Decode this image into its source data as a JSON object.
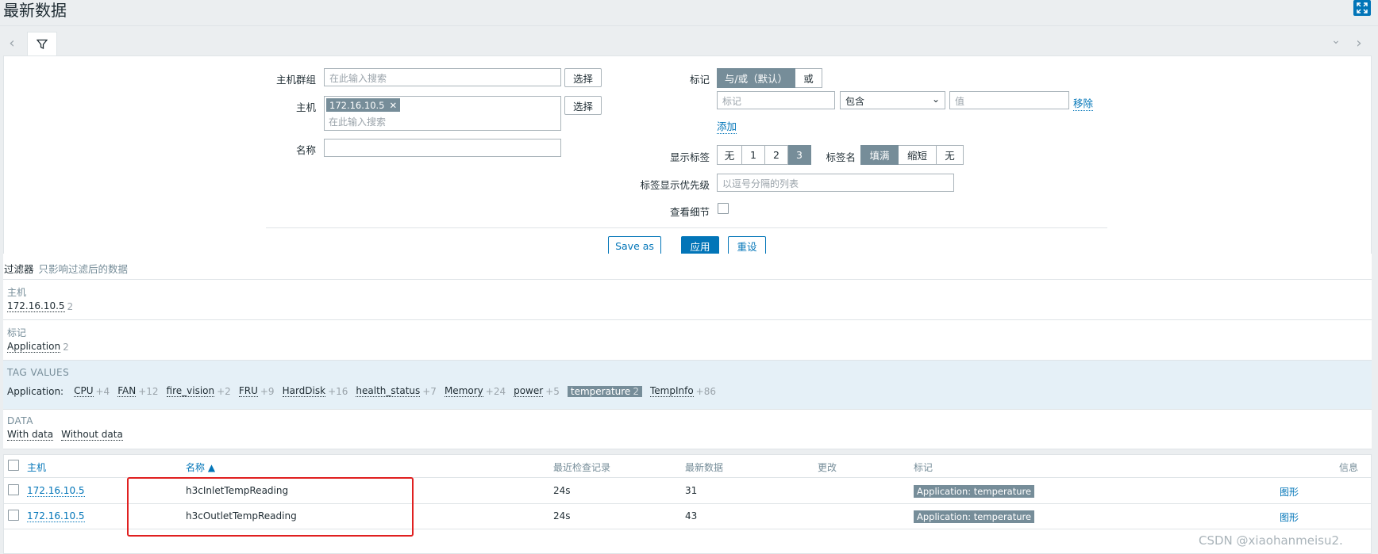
{
  "page": {
    "title": "最新数据"
  },
  "filter": {
    "host_groups_label": "主机群组",
    "host_groups_placeholder": "在此输入搜索",
    "select_label": "选择",
    "hosts_label": "主机",
    "host_chip": "172.16.10.5",
    "hosts_placeholder": "在此输入搜索",
    "name_label": "名称",
    "name_value": "",
    "tags_label": "标记",
    "tags_mode": [
      "与/或（默认）",
      "或"
    ],
    "tag_placeholder": "标记",
    "tag_operator": "包含",
    "value_placeholder": "值",
    "remove_label": "移除",
    "add_label": "添加",
    "show_tags_label": "显示标签",
    "show_tags_options": [
      "无",
      "1",
      "2",
      "3"
    ],
    "tag_name_label": "标签名",
    "tag_name_options": [
      "填满",
      "缩短",
      "无"
    ],
    "tag_priority_label": "标签显示优先级",
    "tag_priority_placeholder": "以逗号分隔的列表",
    "show_details_label": "查看细节",
    "save_as_label": "Save as",
    "apply_label": "应用",
    "reset_label": "重设"
  },
  "subfilter": {
    "title": "过滤器",
    "subtitle": "只影响过滤后的数据",
    "hosts_head": "主机",
    "hosts": [
      {
        "name": "172.16.10.5",
        "count": "2"
      }
    ],
    "tags_head": "标记",
    "tags": [
      {
        "name": "Application",
        "count": "2"
      }
    ],
    "tag_values_head": "TAG VALUES",
    "tag_values_prefix": "Application:",
    "tag_values": [
      {
        "name": "CPU",
        "count": "+4"
      },
      {
        "name": "FAN",
        "count": "+12"
      },
      {
        "name": "fire_vision",
        "count": "+2"
      },
      {
        "name": "FRU",
        "count": "+9"
      },
      {
        "name": "HardDisk",
        "count": "+16"
      },
      {
        "name": "health_status",
        "count": "+7"
      },
      {
        "name": "Memory",
        "count": "+24"
      },
      {
        "name": "power",
        "count": "+5"
      },
      {
        "name": "temperature",
        "count": "2"
      },
      {
        "name": "TempInfo",
        "count": "+86"
      }
    ],
    "data_head": "DATA",
    "data_with": "With data",
    "data_without": "Without data"
  },
  "table": {
    "headers": {
      "host": "主机",
      "name": "名称 ▲",
      "last_check": "最近检查记录",
      "last_value": "最新数据",
      "change": "更改",
      "tags": "标记",
      "info": "信息"
    },
    "rows": [
      {
        "host": "172.16.10.5",
        "name": "h3cInletTempReading",
        "last_check": "24s",
        "last_value": "31",
        "change": "",
        "tag": "Application: temperature",
        "action": "图形"
      },
      {
        "host": "172.16.10.5",
        "name": "h3cOutletTempReading",
        "last_check": "24s",
        "last_value": "43",
        "change": "",
        "tag": "Application: temperature",
        "action": "图形"
      }
    ]
  },
  "watermark": "CSDN @xiaohanmeisu2."
}
